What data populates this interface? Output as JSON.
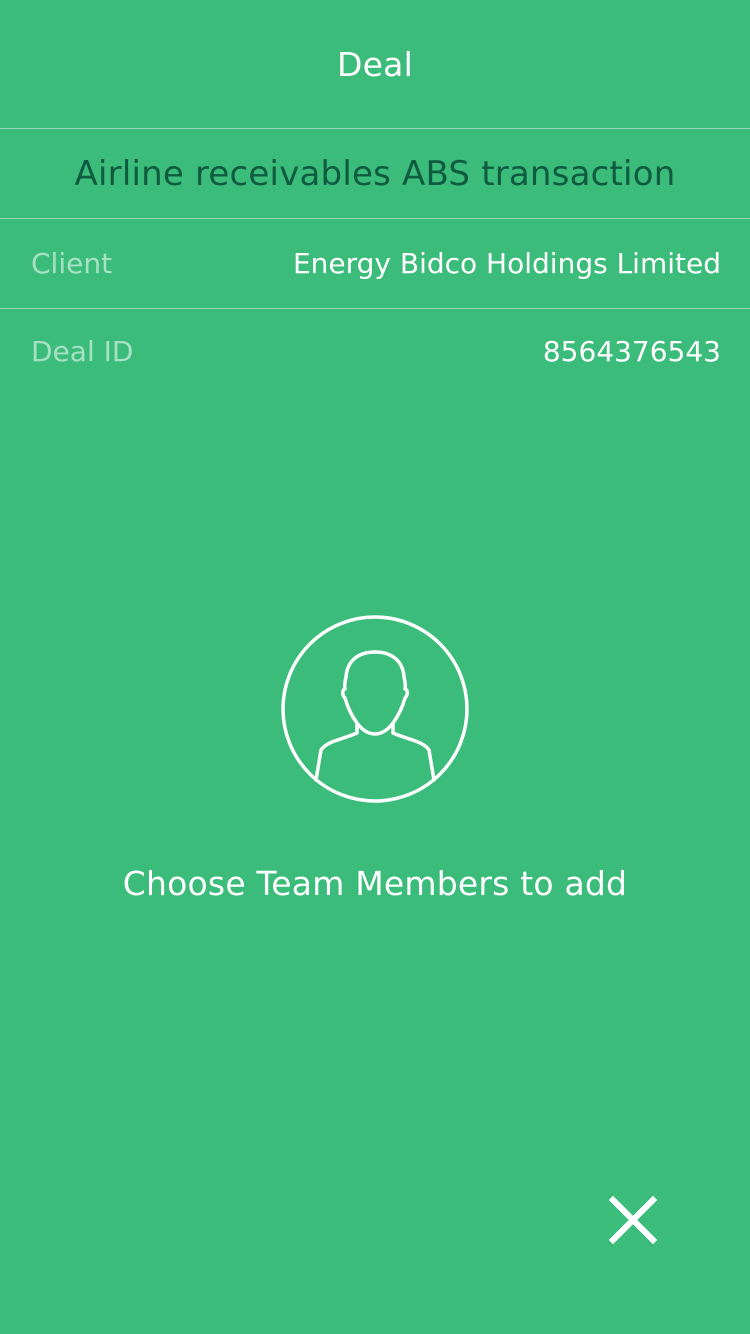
{
  "header": {
    "title": "Deal"
  },
  "deal": {
    "name": "Airline receivables ABS transaction",
    "client_label": "Client",
    "client_value": "Energy Bidco Holdings Limited",
    "id_label": "Deal ID",
    "id_value": "8564376543"
  },
  "empty_state": {
    "icon": "person-icon",
    "message": "Choose Team Members to add"
  },
  "actions": {
    "close_icon": "close-icon"
  },
  "colors": {
    "background": "#3bbc7a",
    "deal_name": "#0f5b3f",
    "text": "#ffffff"
  }
}
